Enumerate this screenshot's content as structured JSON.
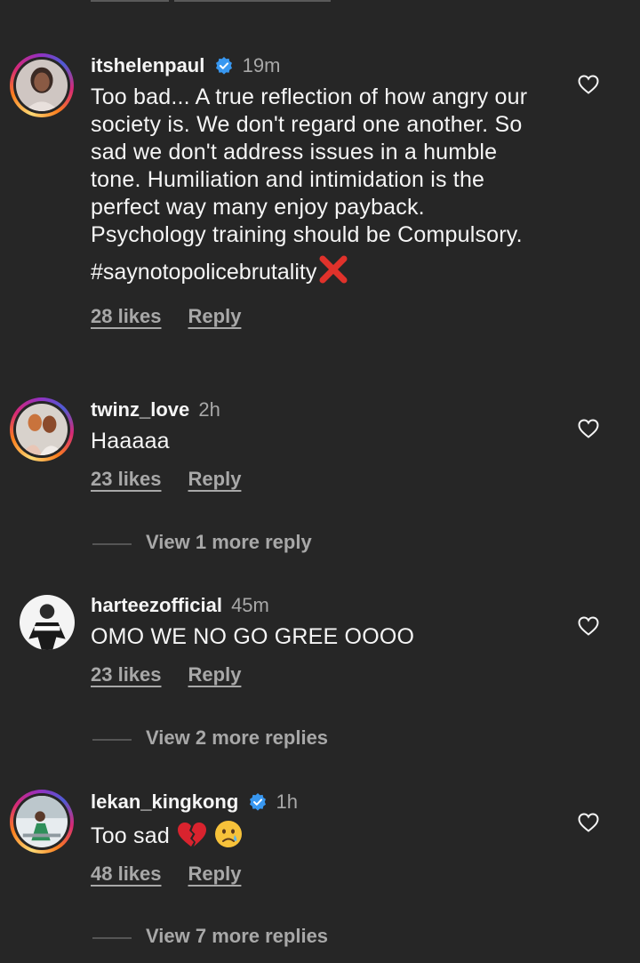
{
  "comments": [
    {
      "username": "itshelenpaul",
      "verified": true,
      "time": "19m",
      "text": "Too bad... A true reflection of how angry our society is. We don't regard one another. So sad we don't address issues in a humble tone. Humiliation and intimidation is the perfect way many enjoy payback. Psychology training should be Compulsory.",
      "hashtag": "#saynotopolicebrutality",
      "likes": "28 likes",
      "reply": "Reply"
    },
    {
      "username": "twinz_love",
      "verified": false,
      "time": "2h",
      "text": "Haaaaa",
      "likes": "23 likes",
      "reply": "Reply",
      "view_replies": "View 1 more reply"
    },
    {
      "username": "harteezofficial",
      "verified": false,
      "time": "45m",
      "text": "OMO WE NO GO GREE OOOO",
      "likes": "23 likes",
      "reply": "Reply",
      "view_replies": "View 2 more replies"
    },
    {
      "username": "lekan_kingkong",
      "verified": true,
      "time": "1h",
      "text": "Too sad",
      "likes": "48 likes",
      "reply": "Reply",
      "view_replies": "View 7 more replies"
    }
  ],
  "icons": {
    "like": "heart-outline-icon",
    "verified": "verified-badge-icon",
    "cross": "cross-mark-emoji",
    "broken_heart": "broken-heart-emoji",
    "crying": "crying-face-emoji"
  },
  "colors": {
    "background": "#262626",
    "primary_text": "#f5f5f5",
    "secondary_text": "#a8a8a8",
    "verified_blue": "#3897f0"
  }
}
